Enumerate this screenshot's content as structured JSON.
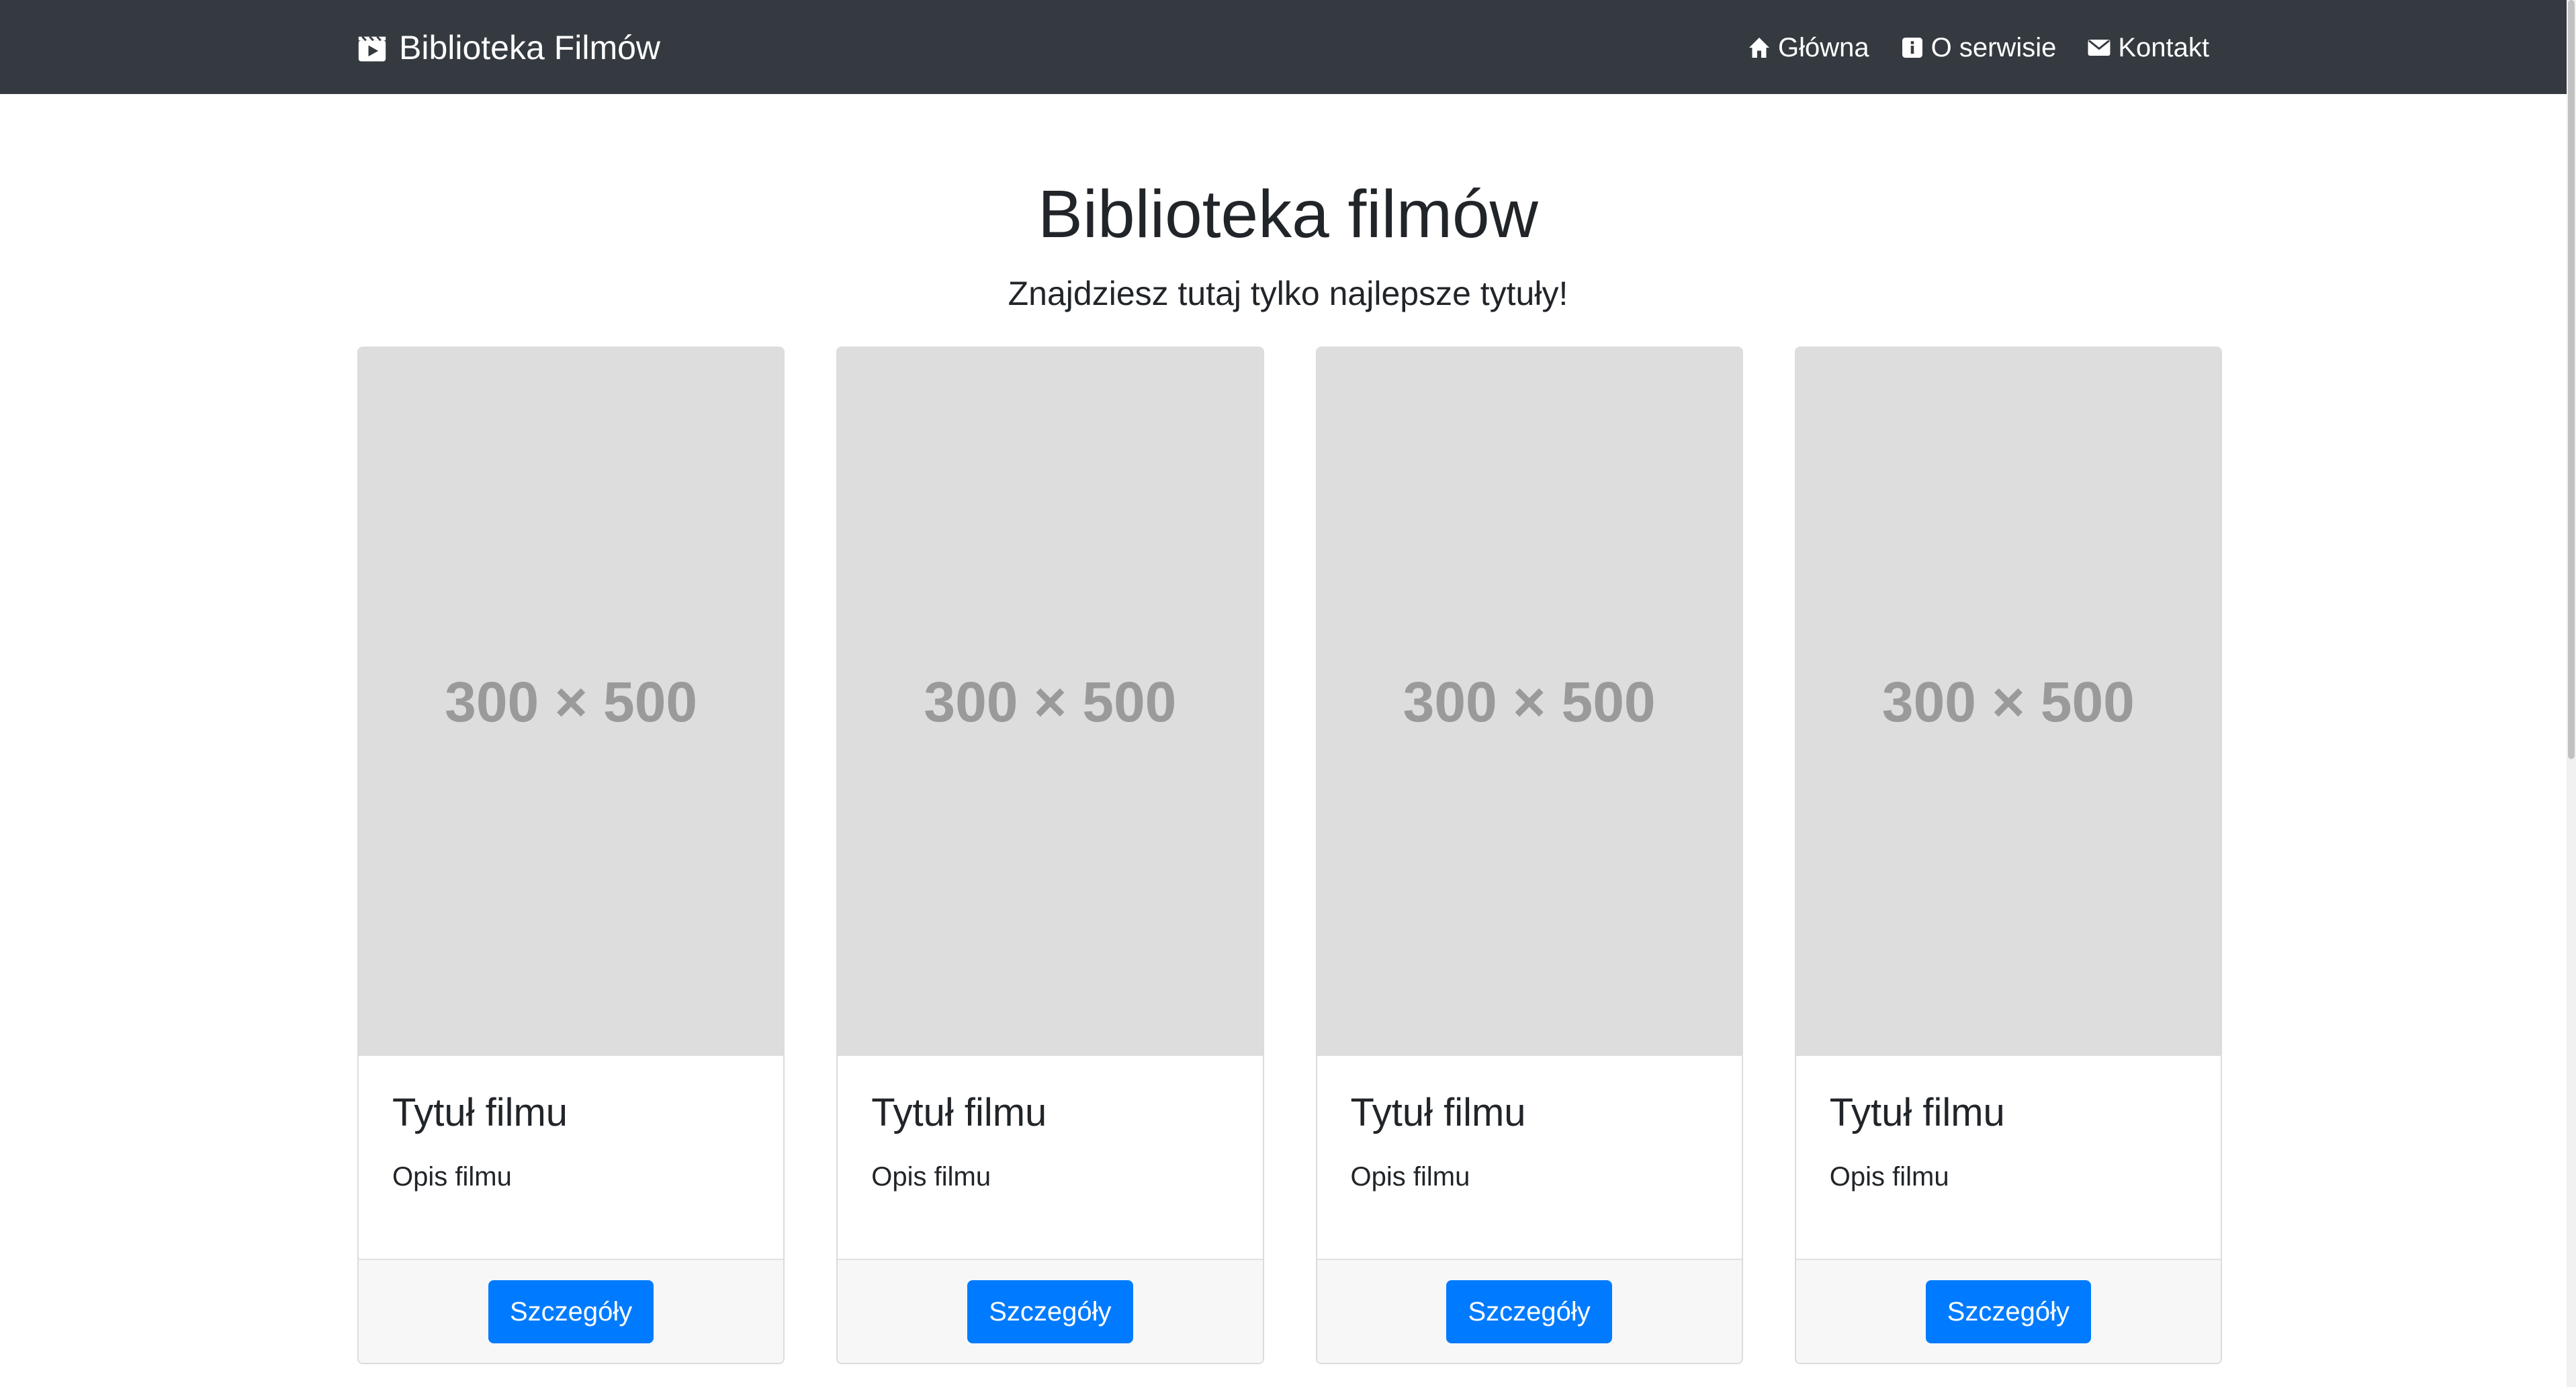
{
  "navbar": {
    "brand": "Biblioteka Filmów",
    "items": [
      {
        "label": "Główna",
        "icon": "home-icon"
      },
      {
        "label": "O serwisie",
        "icon": "info-icon"
      },
      {
        "label": "Kontakt",
        "icon": "envelope-icon"
      }
    ]
  },
  "hero": {
    "title": "Biblioteka filmów",
    "subtitle": "Znajdziesz tutaj tylko najlepsze tytuły!"
  },
  "cards": [
    {
      "image_text": "300 × 500",
      "title": "Tytuł filmu",
      "text": "Opis filmu",
      "button": "Szczegóły"
    },
    {
      "image_text": "300 × 500",
      "title": "Tytuł filmu",
      "text": "Opis filmu",
      "button": "Szczegóły"
    },
    {
      "image_text": "300 × 500",
      "title": "Tytuł filmu",
      "text": "Opis filmu",
      "button": "Szczegóły"
    },
    {
      "image_text": "300 × 500",
      "title": "Tytuł filmu",
      "text": "Opis filmu",
      "button": "Szczegóły"
    }
  ],
  "colors": {
    "navbar_bg": "#343a40",
    "primary": "#007bff",
    "placeholder_bg": "#dddddd",
    "footer_bg": "#f7f7f7"
  }
}
